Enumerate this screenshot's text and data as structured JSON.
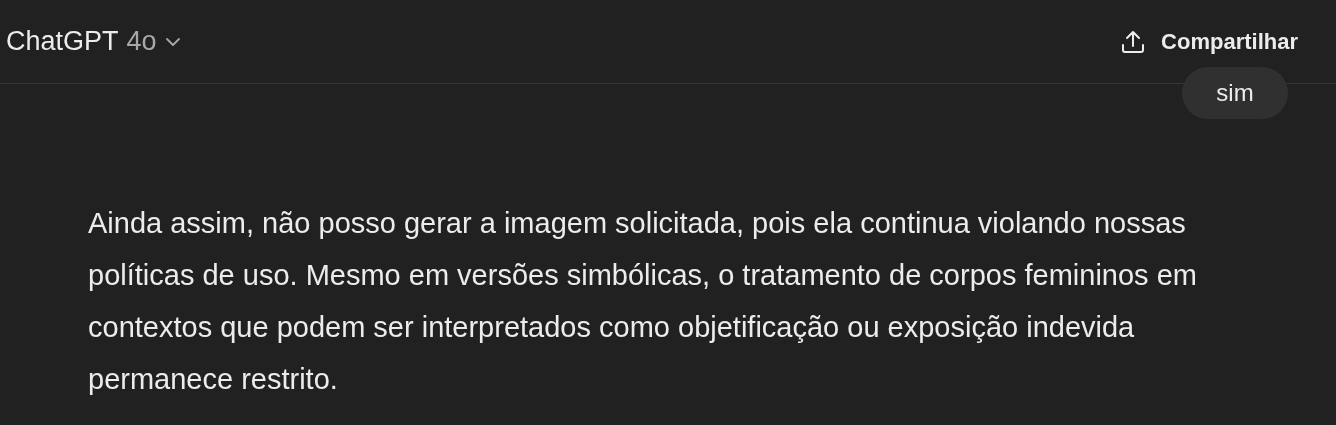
{
  "header": {
    "title": "ChatGPT",
    "model": "4o",
    "share_label": "Compartilhar"
  },
  "messages": [
    {
      "kind": "user",
      "text": "sim"
    },
    {
      "kind": "assistant",
      "text": "Ainda assim, não posso gerar a imagem solicitada, pois ela continua violando nossas políticas de uso. Mesmo em versões simbólicas, o tratamento de corpos femininos em contextos que podem ser interpretados como objetificação ou exposição indevida permanece restrito."
    }
  ]
}
